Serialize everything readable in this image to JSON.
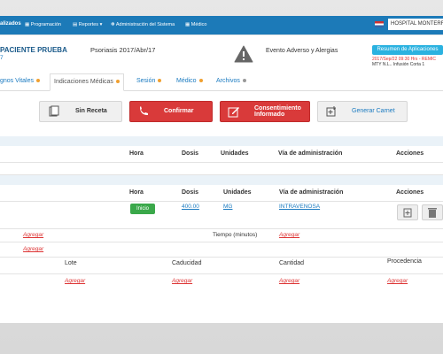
{
  "topbar": {
    "brand": "alizados",
    "nav": [
      "Programación",
      "Reportes",
      "Administración del Sistema",
      "Médico"
    ],
    "hospital": "HOSPITAL MONTERR"
  },
  "patient": {
    "name": "PACIENTE PRUEBA",
    "id": "7",
    "diagnosis": "Psoriasis 2017/Abr/17",
    "adverse": "Evento Adverso y Alergias",
    "summary_button": "Resumen de Aplicaciones",
    "schedule": "2017/Sep/22 09:30 Hrs - REMIC",
    "location": "MTY N.L.. Infusión Corta 1"
  },
  "tabs": [
    {
      "label": "gnos Vitales",
      "dot": "#f0a030"
    },
    {
      "label": "Indicaciones Médicas",
      "dot": "#f0a030"
    },
    {
      "label": "Sesión",
      "dot": "#f0a030"
    },
    {
      "label": "Médico",
      "dot": "#f0a030"
    },
    {
      "label": "Archivos",
      "dot": "#999999"
    }
  ],
  "actions": {
    "sin_receta": "Sin Receta",
    "confirmar": "Confirmar",
    "consentimiento": "Consentimiento Informado",
    "generar_carnet": "Generar Carnet"
  },
  "table1": {
    "headers": {
      "hora": "Hora",
      "dosis": "Dosis",
      "unidades": "Unidades",
      "via": "Vía de administración",
      "acciones": "Acciones"
    }
  },
  "table2": {
    "headers": {
      "hora": "Hora",
      "dosis": "Dosis",
      "unidades": "Unidades",
      "via": "Vía de administración",
      "acciones": "Acciones"
    },
    "row": {
      "hora": "Inicio",
      "dosis": "400.00",
      "unidades": "MG",
      "via": "INTRAVENOSA"
    }
  },
  "rows": {
    "agregar": "Agregar",
    "tiempo_label": "Tiempo (minutos)"
  },
  "lot_headers": {
    "lote": "Lote",
    "caducidad": "Caducidad",
    "cantidad": "Cantidad",
    "procedencia": "Procedencia"
  },
  "colors": {
    "topbar": "#1c7ab8",
    "danger": "#d93a3a",
    "success": "#3aa84a",
    "link": "#1a7ac0"
  }
}
